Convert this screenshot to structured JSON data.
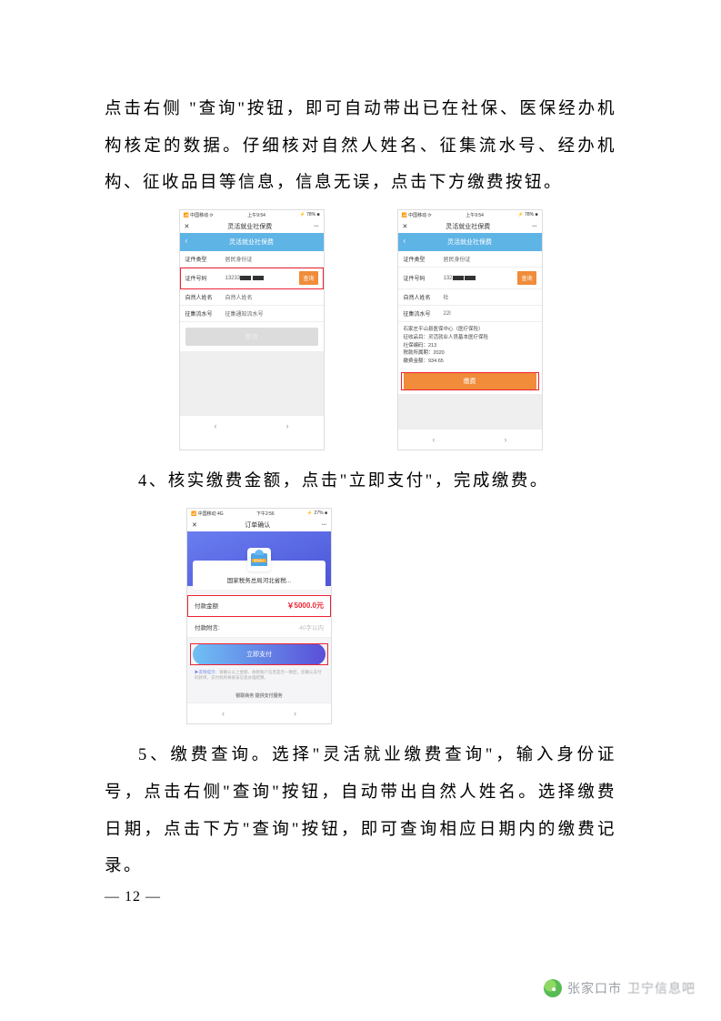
{
  "para1": "点击右侧 \"查询\"按钮，即可自动带出已在社保、医保经办机构核定的数据。仔细核对自然人姓名、征集流水号、经办机构、征收品目等信息，信息无误，点击下方缴费按钮。",
  "para2": "4、核实缴费金额，点击\"立即支付\"，完成缴费。",
  "para3": "5、缴费查询。选择\"灵活就业缴费查询\"，输入身份证号，点击右侧\"查询\"按钮，自动带出自然人姓名。选择缴费日期，点击下方\"查询\"按钮，即可查询相应日期内的缴费记录。",
  "page_num": "— 12 —",
  "watermark": {
    "text_a": "张家口市",
    "text_b": "卫宁信息吧"
  },
  "phone1": {
    "status": {
      "carrier": "中国移动",
      "time": "上午9:54",
      "batt": "78%"
    },
    "nav_title": "灵活就业社保费",
    "header": "灵活就业社保费",
    "rows": {
      "type_lbl": "证件类型",
      "type_val": "居民身份证",
      "id_lbl": "证件号码",
      "id_val_prefix": "13233",
      "query_btn": "查询",
      "name_lbl": "自然人姓名",
      "name_val": "自然人姓名",
      "serial_lbl": "征集流水号",
      "serial_val": "征集通知流水号"
    },
    "big_btn": "查询"
  },
  "phone2": {
    "status": {
      "carrier": "中国移动",
      "time": "上午9:54",
      "batt": "78%"
    },
    "nav_title": "灵活就业社保费",
    "header": "灵活就业社保费",
    "rows": {
      "type_lbl": "证件类型",
      "type_val": "居民身份证",
      "id_lbl": "证件号码",
      "id_val_prefix": "132",
      "query_btn": "查询",
      "name_lbl": "自然人姓名",
      "name_val": "杜",
      "serial_lbl": "征集流水号",
      "serial_val": "22I"
    },
    "info": {
      "l1": "石家庄平山县医保中心（医疗保险）",
      "l2": "征收品目：灵活就业人员基本医疗保险",
      "l3": "社保编码：213",
      "l4_a": "税款所属期：2020",
      "l4_b": "",
      "l5": "缴费金额：934.65"
    },
    "big_btn": "缴费"
  },
  "phone3": {
    "status": {
      "carrier": "中国移动 4G",
      "time": "下午2:56",
      "batt": "27%"
    },
    "nav_title": "订单确认",
    "merchant_badge": "收款商户",
    "merchant": "国家税务总局河北省税...",
    "amount_lbl": "付款金额",
    "amount_val": "￥5000.0元",
    "note_lbl": "付款附言:",
    "note_ph": "40字以内",
    "pay_btn": "立即支付",
    "tip_b": "▶友情提示：",
    "tip": "请确认以上金额、收款账户信息是否一致后，您确认支付的款项，支付机构将按该信息办理结算。",
    "footer": "银联商务 提供支付服务"
  }
}
